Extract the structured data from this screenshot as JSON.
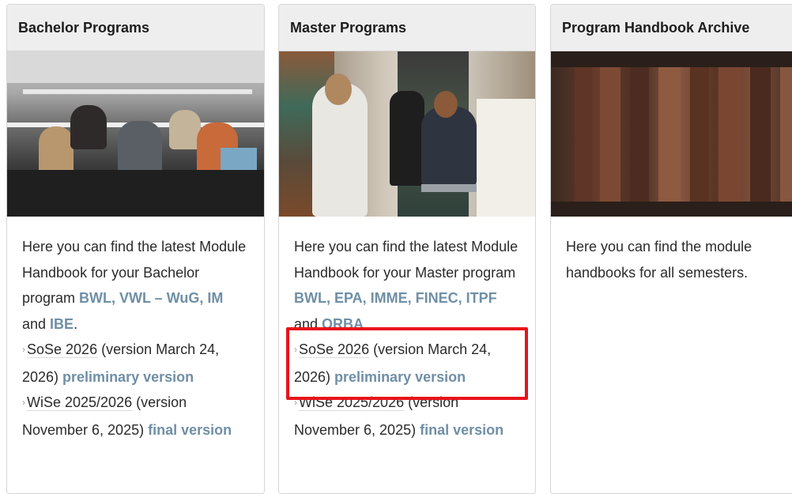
{
  "cards": [
    {
      "title": "Bachelor Programs",
      "intro_text": "Here you can find the latest Module Handbook for your Bachelor program ",
      "programs_a": "BWL, VWL – WuG, IM",
      "and_text": " and ",
      "programs_b": "IBE",
      "end_text": ".",
      "entries": [
        {
          "arrow": "›",
          "term": "SoSe 2026",
          "details": " (version March 24, 2026) ",
          "link": "preliminary version"
        },
        {
          "arrow": "›",
          "term": "WiSe 2025/2026",
          "details": " (version November 6, 2025) ",
          "link": "final version"
        }
      ]
    },
    {
      "title": "Master Programs",
      "intro_text": "Here you can find the latest Module Handbook for your Master program ",
      "programs_a": "BWL, EPA, IMME, FINEC, ITPF",
      "and_text": " and ",
      "programs_b": "ORBA",
      "end_text": ".",
      "entries": [
        {
          "arrow": "›",
          "term": "SoSe 2026",
          "details": " (version March 24, 2026) ",
          "link": "preliminary version"
        },
        {
          "arrow": "›",
          "term": "WiSe 2025/2026",
          "details": " (version November 6, 2025) ",
          "link": "final version"
        }
      ]
    },
    {
      "title": "Program Handbook Archive",
      "intro_text": "Here you can find the module handbooks for all semesters."
    }
  ],
  "colors": {
    "link": "#6f8fa6",
    "highlight": "#e8141b",
    "header_bg": "#eeeeee"
  }
}
